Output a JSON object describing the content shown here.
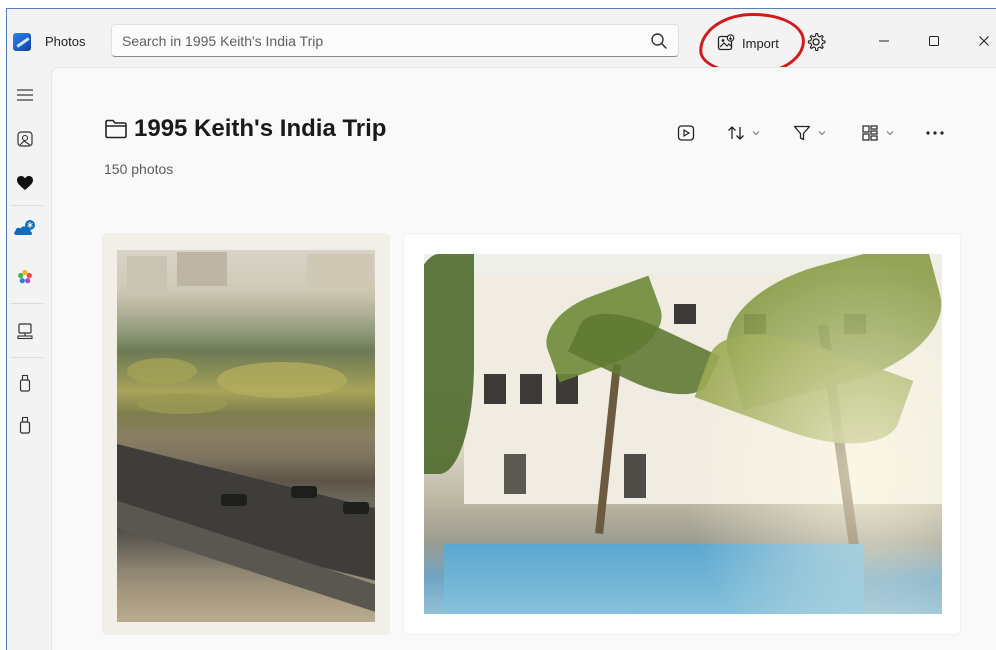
{
  "app": {
    "title": "Photos"
  },
  "search": {
    "placeholder": "Search in 1995 Keith's India Trip"
  },
  "toolbar": {
    "import_label": "Import"
  },
  "nav": {
    "items": [
      {
        "name": "menu",
        "icon": "hamburger-icon"
      },
      {
        "name": "gallery",
        "icon": "gallery-icon"
      },
      {
        "name": "favorites",
        "icon": "heart-icon"
      },
      {
        "name": "onedrive",
        "icon": "cloud-icon"
      },
      {
        "name": "icloud",
        "icon": "flower-icon"
      },
      {
        "name": "this-pc",
        "icon": "computer-icon"
      },
      {
        "name": "folder-1",
        "icon": "usb-drive-icon"
      },
      {
        "name": "folder-2",
        "icon": "usb-drive-icon"
      }
    ]
  },
  "album": {
    "title": "1995 Keith's India Trip",
    "count": "150 photos"
  },
  "photos": [
    {
      "name": "photo-street-garden"
    },
    {
      "name": "photo-hotel-pool"
    }
  ],
  "colors": {
    "accent": "#0f6cbd",
    "highlight": "#d11a1a"
  }
}
